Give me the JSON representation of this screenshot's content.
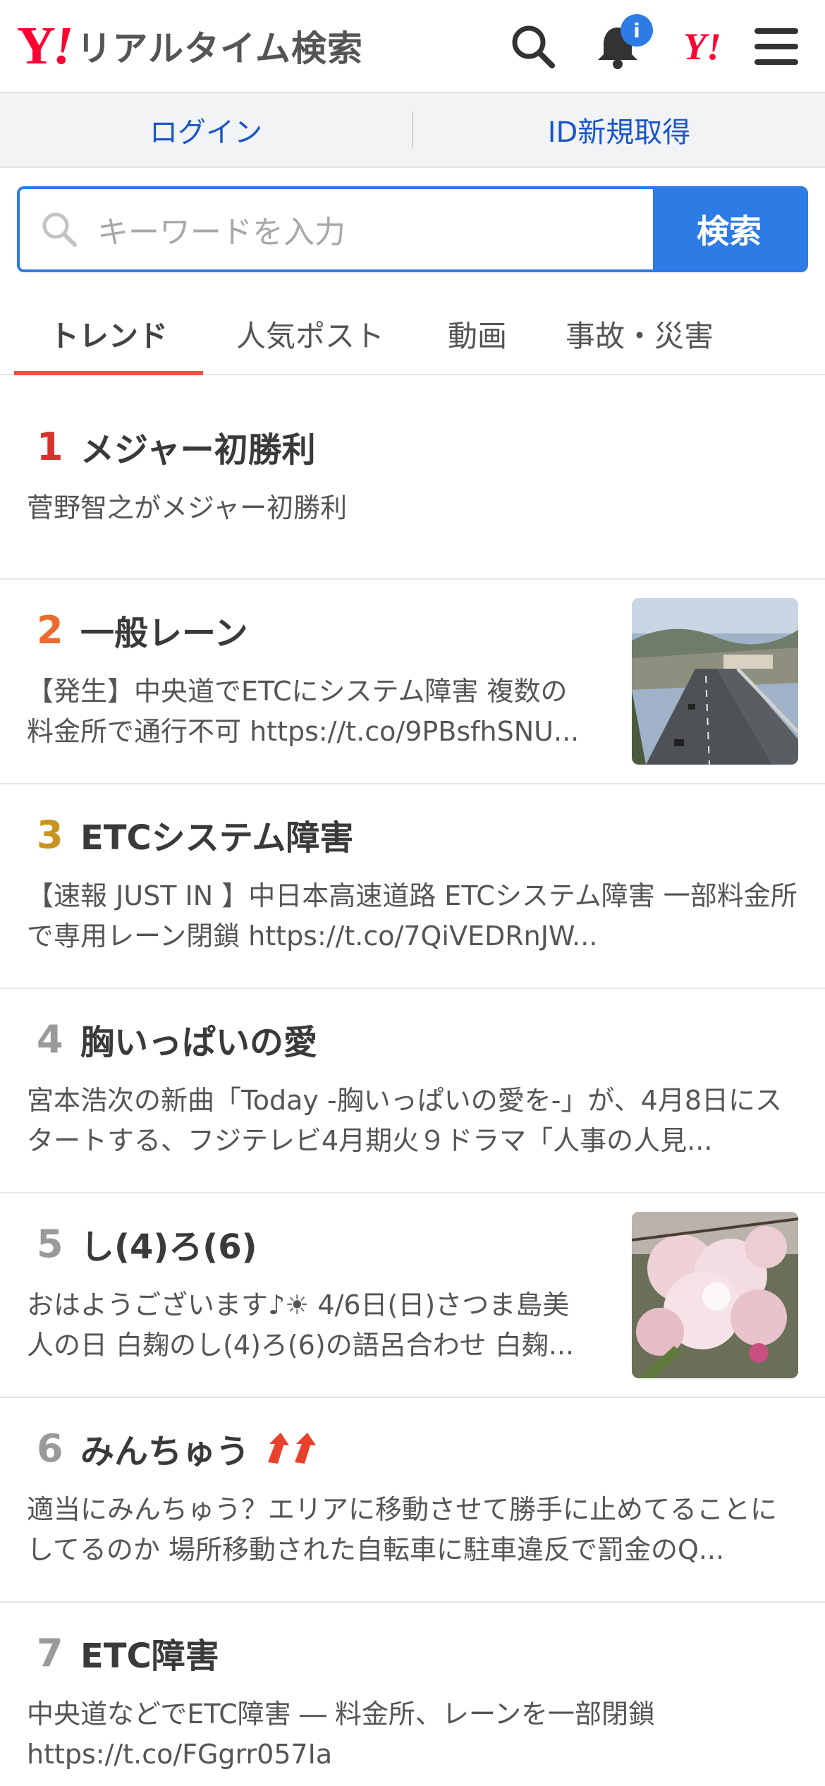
{
  "header": {
    "logo_y": "Y",
    "logo_bang": "!",
    "logo_text": "リアルタイム検索",
    "notification_badge": "i",
    "yj_logo": "Y!"
  },
  "account": {
    "login": "ログイン",
    "signup": "ID新規取得"
  },
  "search": {
    "placeholder": "キーワードを入力",
    "button": "検索"
  },
  "tabs": [
    {
      "label": "トレンド",
      "active": true
    },
    {
      "label": "人気ポスト",
      "active": false
    },
    {
      "label": "動画",
      "active": false
    },
    {
      "label": "事故・災害",
      "active": false
    }
  ],
  "trends": [
    {
      "rank": "1",
      "title": "メジャー初勝利",
      "desc": "菅野智之がメジャー初勝利"
    },
    {
      "rank": "2",
      "title": "一般レーン",
      "desc": "【発生】中央道でETCにシステム障害 複数の料金所で通行不可 https://t.co/9PBsfhSNU..."
    },
    {
      "rank": "3",
      "title": "ETCシステム障害",
      "desc": "【速報 JUST IN 】中日本高速道路 ETCシステム障害 一部料金所で専用レーン閉鎖 https://t.co/7QiVEDRnJW..."
    },
    {
      "rank": "4",
      "title": "胸いっぱいの愛",
      "desc": "宮本浩次の新曲「Today -胸いっぱいの愛を-」が、4月8日にスタートする、フジテレビ4月期火９ドラマ「人事の人見..."
    },
    {
      "rank": "5",
      "title": "し(4)ろ(6)",
      "desc": "おはようございます♪☀ 4/6日(日)さつま島美人の日 白麹のし(4)ろ(6)の語呂合わせ 白麹..."
    },
    {
      "rank": "6",
      "title": "みんちゅう",
      "desc": "適当にみんちゅう？エリアに移動させて勝手に止めてることにしてるのか 場所移動された自転車に駐車違反で罰金のQ..."
    },
    {
      "rank": "7",
      "title": "ETC障害",
      "desc": "中央道などでETC障害 ― 料金所、レーンを一部閉鎖 https://t.co/FGgrr057Ia"
    }
  ],
  "icons": {
    "search": "search-icon",
    "bell": "bell-icon",
    "menu": "hamburger-menu-icon",
    "rising": "rising-arrows-icon"
  },
  "colors": {
    "accent_blue": "#2d7be5",
    "brand_red": "#ff0033",
    "tab_underline": "#e8533f",
    "rank1": "#d8322c",
    "rank2": "#ed6a2e",
    "rank3": "#c9931e",
    "rank_other": "#9a9a9a"
  }
}
